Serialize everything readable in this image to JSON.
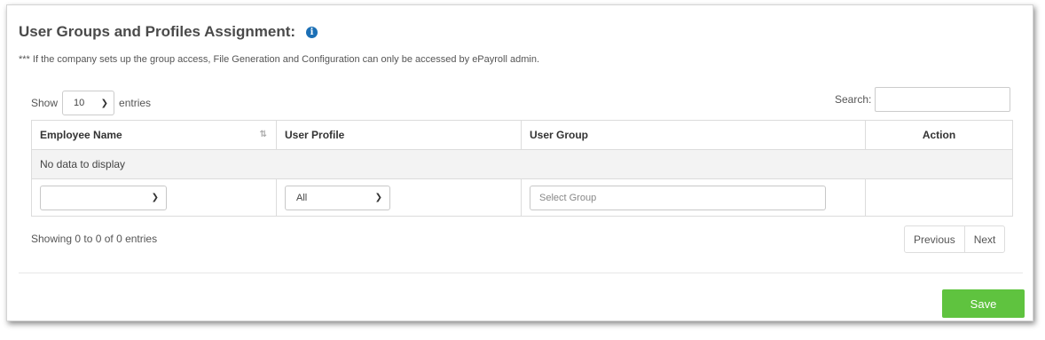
{
  "header": {
    "title": "User Groups and Profiles Assignment:",
    "info_icon": "i",
    "note": "*** If the company sets up the group access, File Generation and Configuration can only be accessed by ePayroll admin."
  },
  "controls": {
    "show_label": "Show",
    "page_length": "10",
    "entries_label": "entries",
    "search_label": "Search:",
    "search_value": ""
  },
  "table": {
    "columns": [
      "Employee Name",
      "User Profile",
      "User Group",
      "Action"
    ],
    "empty_message": "No data to display",
    "filters": {
      "employee_name": "",
      "user_profile": "All",
      "user_group_placeholder": "Select Group"
    }
  },
  "footer": {
    "info": "Showing 0 to 0 of 0 entries",
    "previous": "Previous",
    "next": "Next",
    "save": "Save"
  },
  "colors": {
    "save_button": "#5fc33f",
    "info_icon": "#1b6fb5"
  }
}
